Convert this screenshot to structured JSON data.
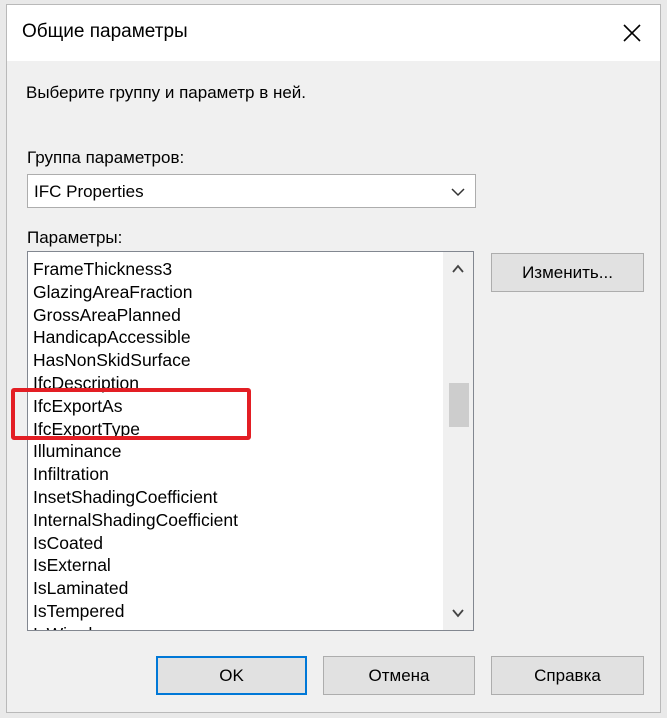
{
  "window": {
    "title": "Общие параметры",
    "close_symbol": "✕"
  },
  "prompt": "Выберите группу и параметр в ней.",
  "group": {
    "label": "Группа параметров:",
    "selected": "IFC Properties"
  },
  "params": {
    "label": "Параметры:",
    "items": [
      "FrameThickness3",
      "GlazingAreaFraction",
      "GrossAreaPlanned",
      "HandicapAccessible",
      "HasNonSkidSurface",
      "IfcDescription",
      "IfcExportAs",
      "IfcExportType",
      "Illuminance",
      "Infiltration",
      "InsetShadingCoefficient",
      "InternalShadingCoefficient",
      "IsCoated",
      "IsExternal",
      "IsLaminated",
      "IsTempered",
      "IsWired"
    ],
    "highlighted": [
      "IfcExportAs",
      "IfcExportType"
    ],
    "highlight_color": "#e31e24"
  },
  "buttons": {
    "change": "Изменить...",
    "ok": "OK",
    "cancel": "Отмена",
    "help": "Справка"
  },
  "colors": {
    "accent": "#0078d7",
    "dialog_bg": "#f0f0f0",
    "button_bg": "#e1e1e1"
  }
}
